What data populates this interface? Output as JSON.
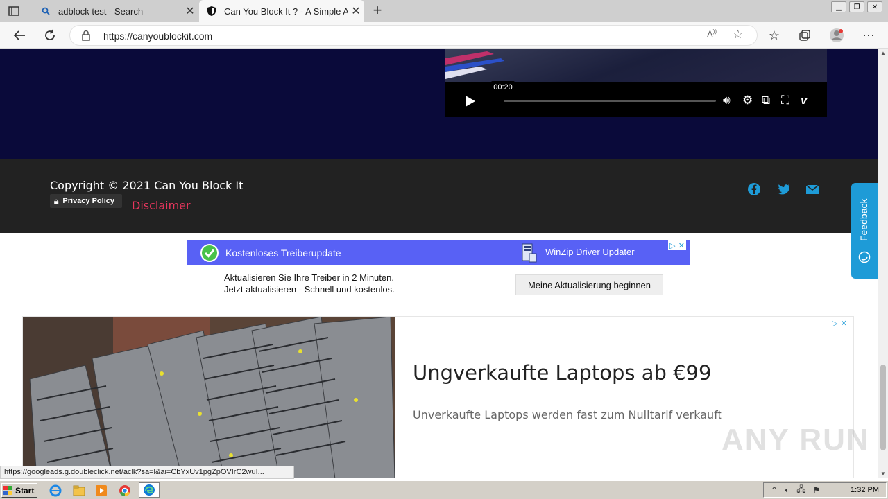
{
  "tabs": [
    {
      "title": "adblock test - Search",
      "close": "✕"
    },
    {
      "title": "Can You Block It ? - A Simple Ad Block Tester",
      "close": "✕"
    }
  ],
  "new_tab": "+",
  "address": {
    "url": "https://canyoublockit.com"
  },
  "video": {
    "time_tooltip": "00:20"
  },
  "footer": {
    "copyright": "Copyright © 2021 Can You Block It",
    "privacy": "Privacy Policy",
    "disclaimer": "Disclaimer"
  },
  "feedback": {
    "label": "Feedback"
  },
  "ad1": {
    "title": "Kostenloses Treiberupdate",
    "brand": "WinZip Driver Updater",
    "line1": "Aktualisieren Sie Ihre Treiber in 2 Minuten.",
    "line2": "Jetzt aktualisieren - Schnell und kostenlos.",
    "cta": "Meine Aktualisierung beginnen"
  },
  "ad2": {
    "headline": "Ungverkaufte Laptops ab €99",
    "sub": "Unverkaufte Laptops werden fast zum Nulltarif verkauft"
  },
  "watermark": "ANY RUN",
  "status_url": "https://googleads.g.doubleclick.net/aclk?sa=l&ai=CbYxUv1pgZpOVIrC2wuI...",
  "taskbar": {
    "start": "Start",
    "clock": "1:32 PM"
  },
  "colors": {
    "navy": "#0a0a3a",
    "footer": "#222222",
    "accent": "#e8365d",
    "social": "#1e9bd7",
    "ad_banner": "#5861f5"
  }
}
